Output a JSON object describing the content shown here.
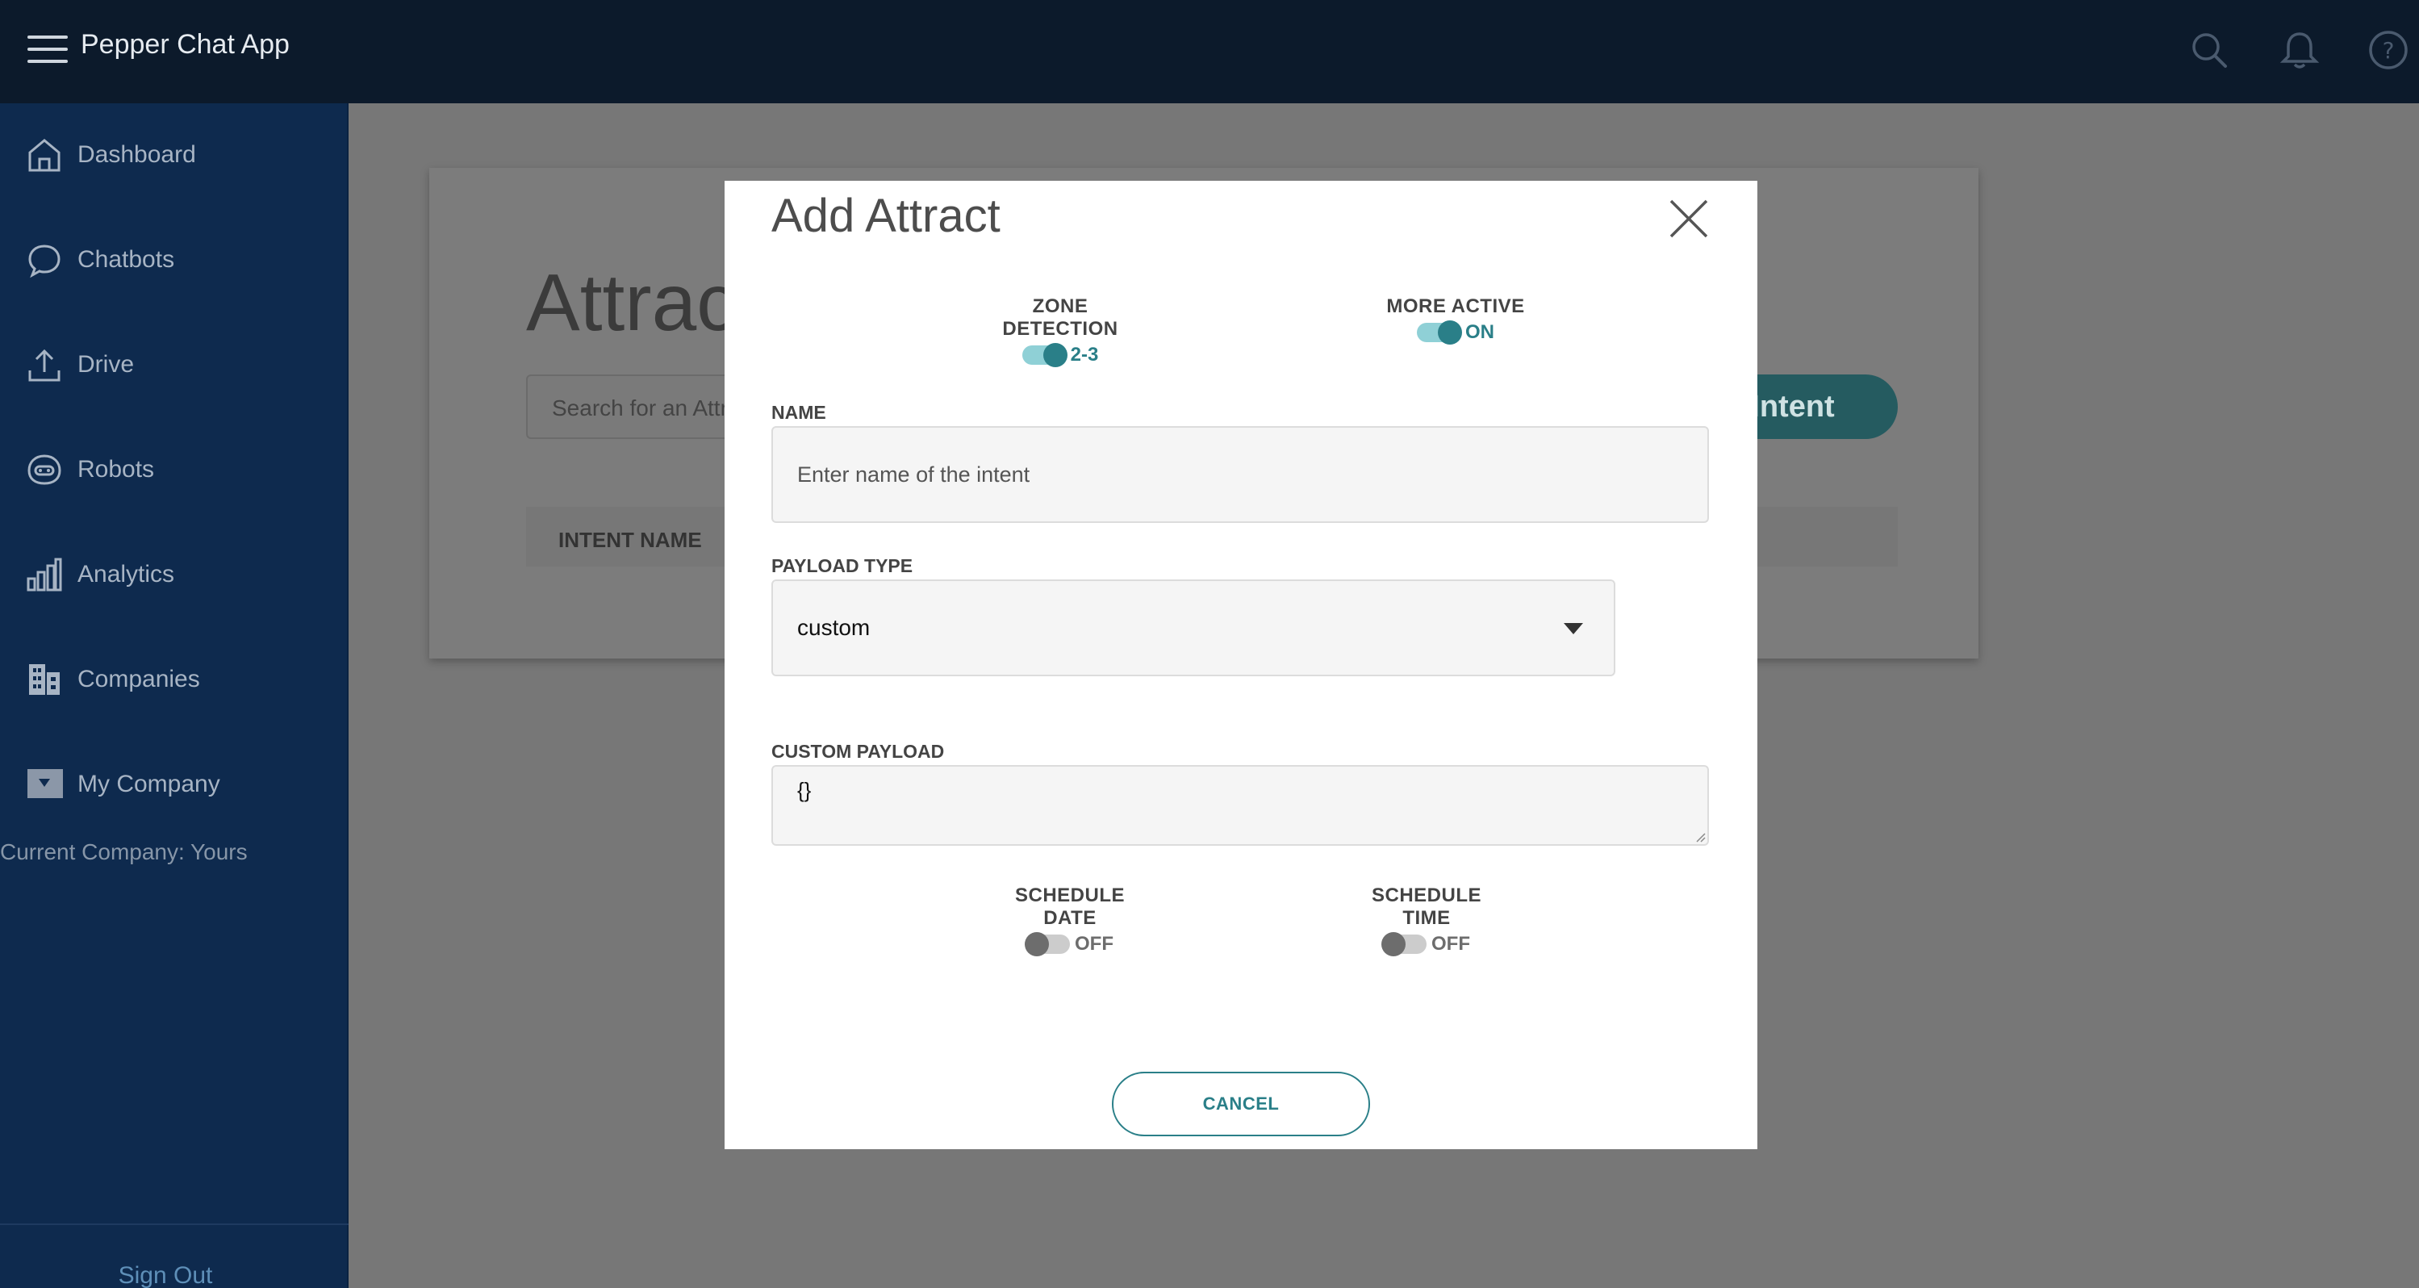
{
  "app": {
    "title": "Pepper Chat App"
  },
  "topbar": {
    "icons": [
      "search-icon",
      "bell-icon",
      "help-icon"
    ]
  },
  "sidebar": {
    "items": [
      {
        "label": "Dashboard",
        "icon": "home-icon"
      },
      {
        "label": "Chatbots",
        "icon": "chat-bubble-icon"
      },
      {
        "label": "Drive",
        "icon": "upload-icon"
      },
      {
        "label": "Robots",
        "icon": "robot-icon"
      },
      {
        "label": "Analytics",
        "icon": "bar-chart-icon"
      },
      {
        "label": "Companies",
        "icon": "building-icon"
      },
      {
        "label": "My Company",
        "icon": "company-dropdown-icon"
      }
    ],
    "current_company": "Current Company: Yours",
    "sign_out": "Sign Out"
  },
  "page": {
    "heading": "Attrac",
    "search_placeholder": "Search for an Attra",
    "intent_button": "Intent",
    "table_header": "INTENT NAME"
  },
  "modal": {
    "title": "Add Attract",
    "zone_detection": {
      "label": "ZONE DETECTION",
      "state": "2-3",
      "on": true
    },
    "more_active": {
      "label": "MORE ACTIVE",
      "state": "ON",
      "on": true
    },
    "name": {
      "label": "NAME",
      "placeholder": "Enter name of the intent"
    },
    "payload_type": {
      "label": "PAYLOAD TYPE",
      "value": "custom"
    },
    "custom_payload": {
      "label": "CUSTOM PAYLOAD",
      "value": "{}"
    },
    "schedule_date": {
      "label": "SCHEDULE DATE",
      "state": "OFF",
      "on": false
    },
    "schedule_time": {
      "label": "SCHEDULE TIME",
      "state": "OFF",
      "on": false
    },
    "cancel": "CANCEL"
  },
  "colors": {
    "topbar": "#0c1a2b",
    "sidebar": "#0e2a4e",
    "accent": "#2a7f88",
    "overlay": "#777777"
  }
}
